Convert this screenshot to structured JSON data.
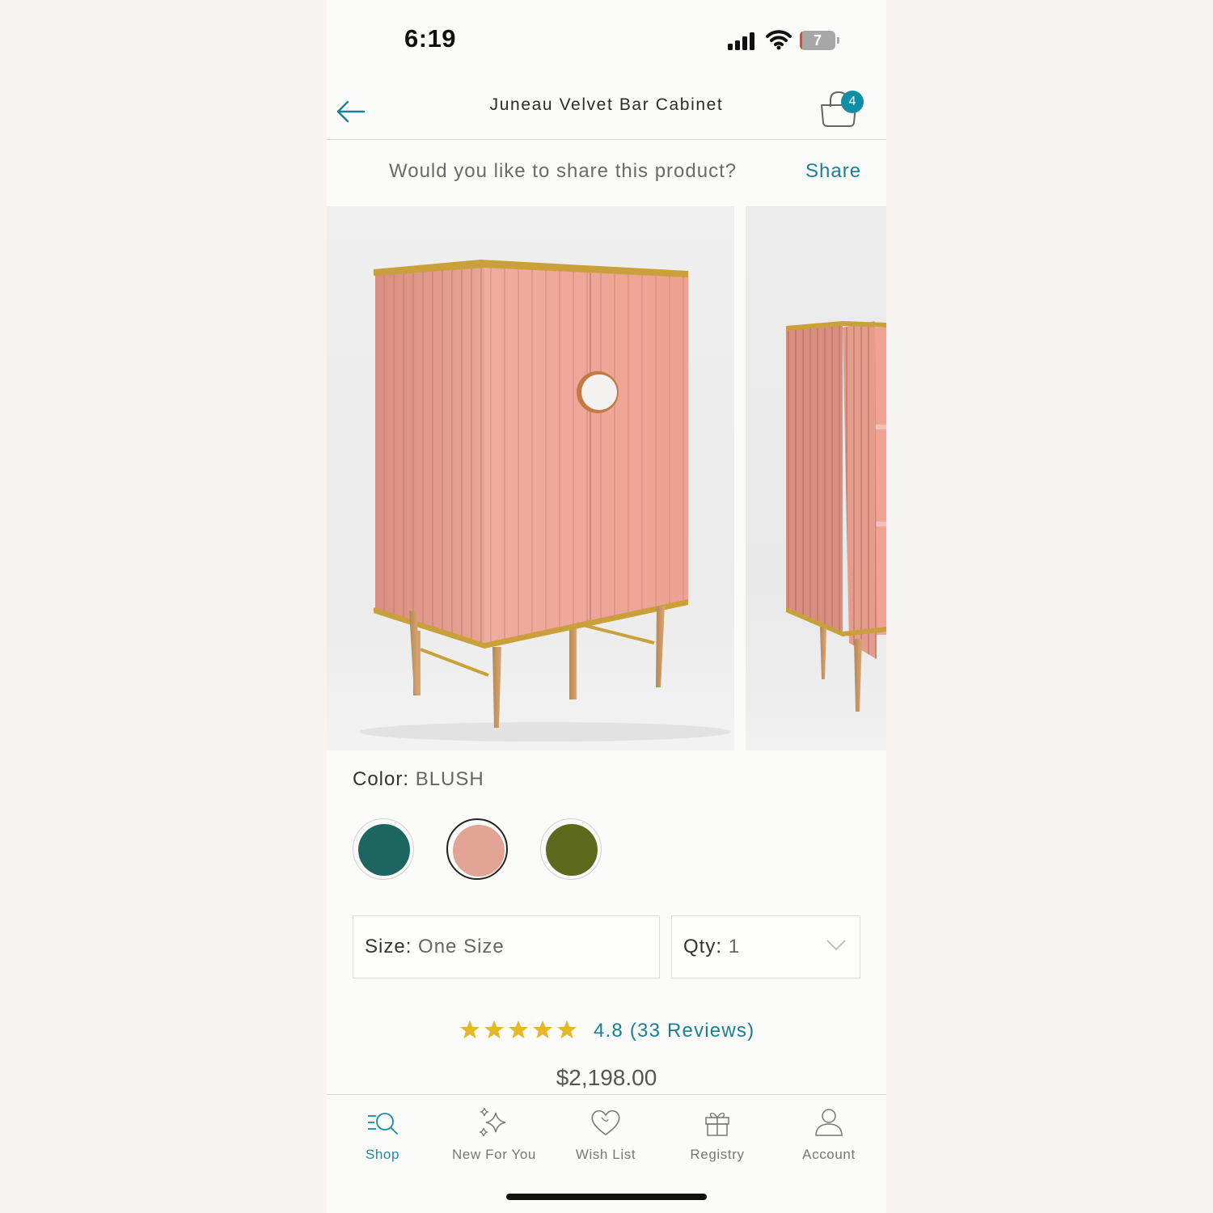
{
  "status_bar": {
    "time": "6:19",
    "battery": "7",
    "battery_level": 0.07
  },
  "header": {
    "title": "Juneau Velvet Bar Cabinet",
    "cart_count": "4",
    "back_icon": "arrow-left-icon",
    "cart_icon": "shopping-bag-icon"
  },
  "share": {
    "prompt": "Would you like to share this product?",
    "link": "Share"
  },
  "product": {
    "color_label": "Color:",
    "color_value": "BLUSH",
    "swatches": [
      {
        "name": "Teal",
        "color": "#1c6561",
        "selected": false
      },
      {
        "name": "Blush",
        "color": "#e1a394",
        "selected": true
      },
      {
        "name": "Olive",
        "color": "#5d6a1e",
        "selected": false
      }
    ],
    "size_label": "Size:",
    "size_value": "One Size",
    "qty_label": "Qty:",
    "qty_value": "1",
    "rating_stars": 5,
    "rating_text": "4.8 (33 Reviews)",
    "price": "$2,198.00"
  },
  "tabs": [
    {
      "label": "Shop",
      "icon": "search-list-icon",
      "active": true
    },
    {
      "label": "New For You",
      "icon": "sparkles-icon",
      "active": false
    },
    {
      "label": "Wish List",
      "icon": "heart-icon",
      "active": false
    },
    {
      "label": "Registry",
      "icon": "gift-icon",
      "active": false
    },
    {
      "label": "Account",
      "icon": "person-icon",
      "active": false
    }
  ],
  "colors": {
    "accent": "#1b7f93",
    "badge": "#0f8fa3",
    "star": "#e5b82a",
    "cabinet_pink": "#eba597",
    "brass": "#c9a03a"
  }
}
